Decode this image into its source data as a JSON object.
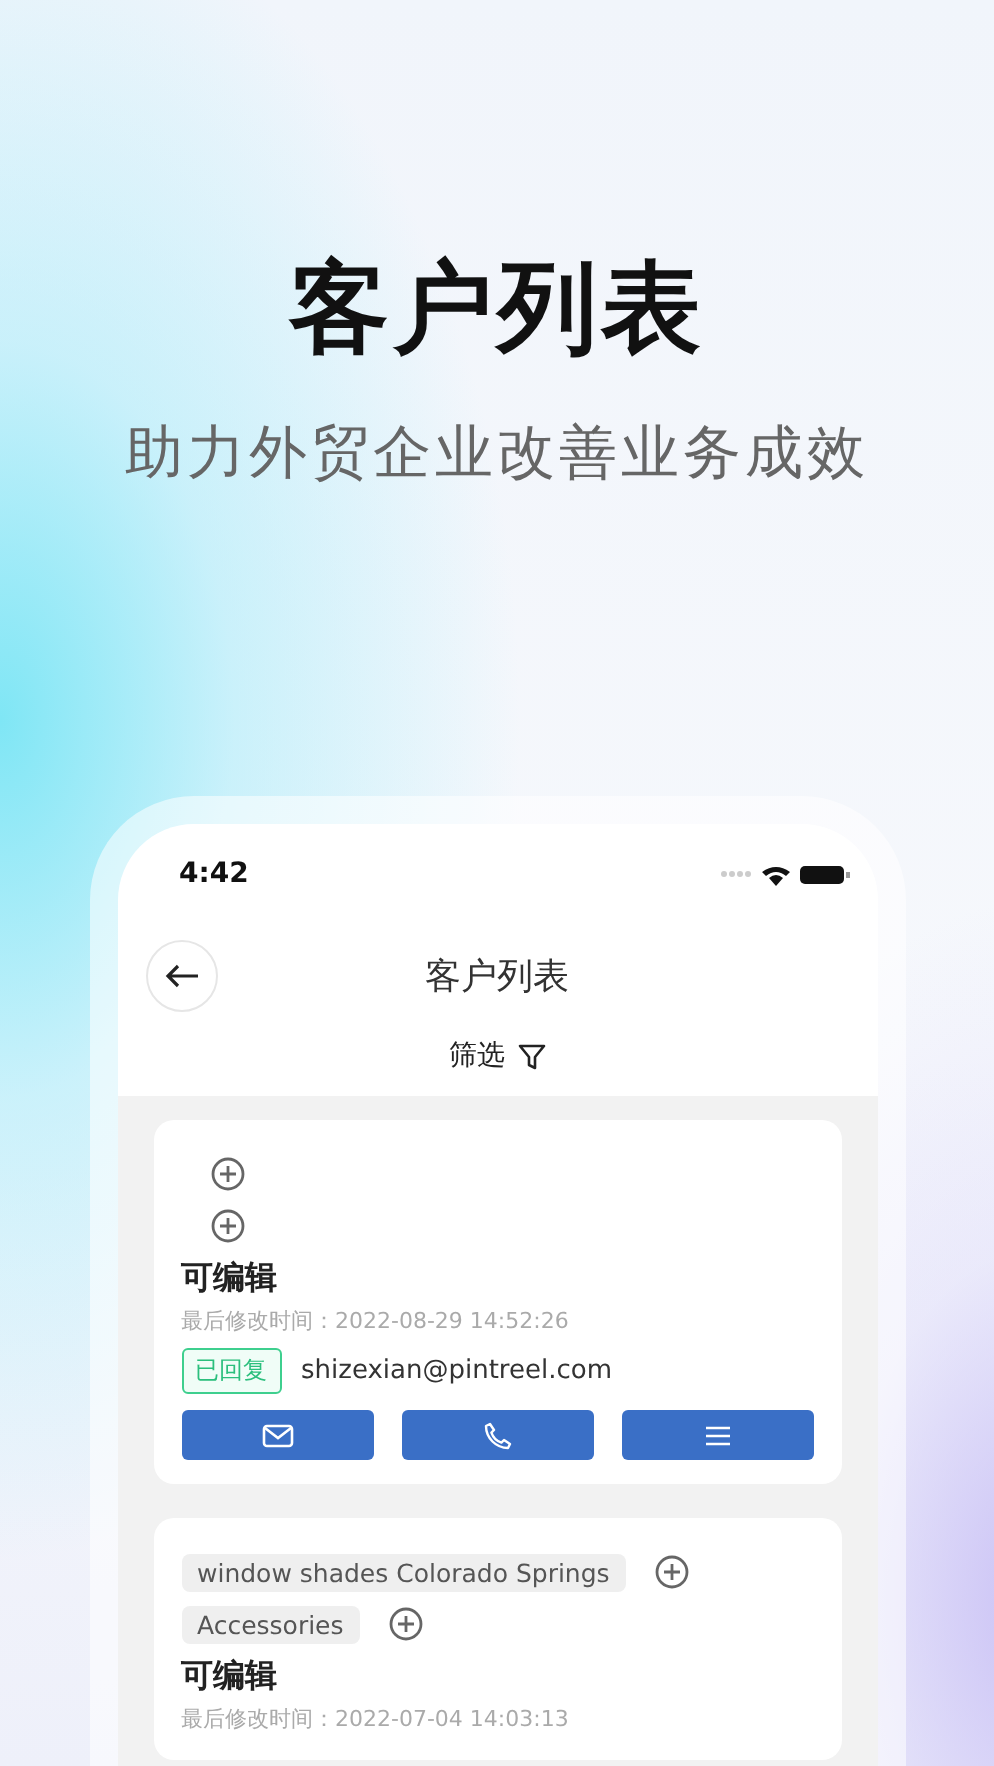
{
  "headline": "客户列表",
  "subheadline": "助力外贸企业改善业务成效",
  "status_bar": {
    "time": "4:42"
  },
  "nav": {
    "title": "客户列表"
  },
  "filter": {
    "label": "筛选"
  },
  "customers": [
    {
      "tag_rows": [
        {},
        {}
      ],
      "name": "可编辑",
      "modified": "最后修改时间：2022-08-29 14:52:26",
      "status": {
        "label": "已回复",
        "kind": "replied"
      },
      "email": "shizexian@pintreel.com",
      "actions": [
        {
          "kind": "mail"
        },
        {
          "kind": "phone"
        },
        {
          "kind": "menu"
        }
      ]
    },
    {
      "tag_rows": [
        {
          "tag": "window shades Colorado Springs"
        },
        {
          "tag": "Accessories"
        }
      ],
      "name": "可编辑",
      "modified": "最后修改时间：2022-07-04 14:03:13"
    }
  ]
}
